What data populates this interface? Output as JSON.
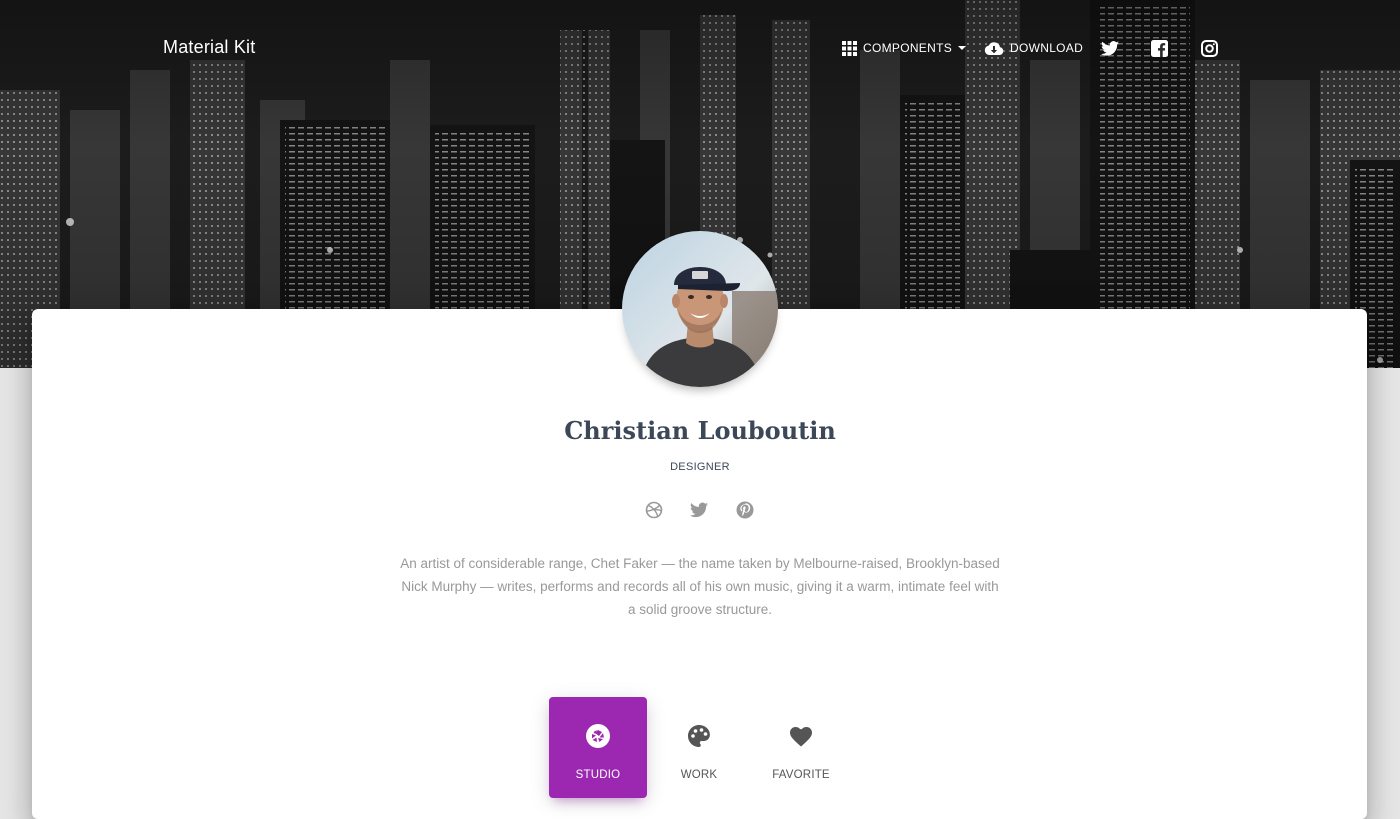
{
  "navbar": {
    "brand": "Material Kit",
    "components_label": "COMPONENTS",
    "download_label": "DOWNLOAD",
    "components_icon": "apps-grid-icon",
    "download_icon": "cloud-download-icon",
    "social_icons": [
      "twitter-icon",
      "facebook-icon",
      "instagram-icon"
    ]
  },
  "hero": {
    "background": "night city skyline (grayscale)"
  },
  "profile": {
    "name": "Christian Louboutin",
    "title": "DESIGNER",
    "social_icons": [
      "dribbble-icon",
      "twitter-icon",
      "pinterest-icon"
    ],
    "bio": "An artist of considerable range, Chet Faker — the name taken by Melbourne-raised, Brooklyn-based Nick Murphy — writes, performs and records all of his own music, giving it a warm, intimate feel with a solid groove structure."
  },
  "tabs": [
    {
      "label": "STUDIO",
      "icon": "camera-aperture-icon",
      "active": true
    },
    {
      "label": "WORK",
      "icon": "palette-icon",
      "active": false
    },
    {
      "label": "FAVORITE",
      "icon": "heart-icon",
      "active": false
    }
  ],
  "colors": {
    "accent": "#9c27b0",
    "heading": "#3c4858",
    "muted_text": "#999999",
    "page_background": "#e5e5e5"
  }
}
